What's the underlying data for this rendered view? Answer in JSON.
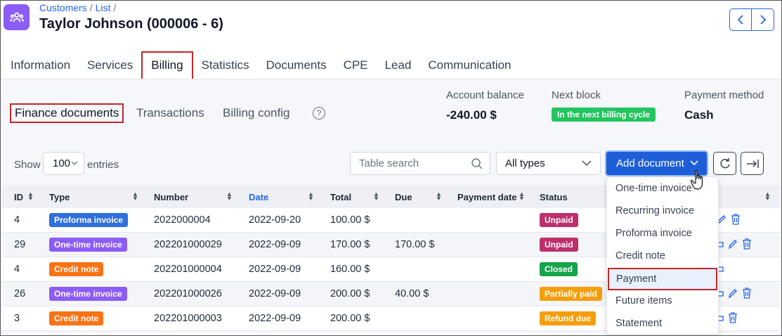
{
  "breadcrumb": {
    "customers": "Customers",
    "list": "List"
  },
  "page_title": "Taylor Johnson (000006 - 6)",
  "tabs": [
    {
      "label": "Information"
    },
    {
      "label": "Services"
    },
    {
      "label": "Billing"
    },
    {
      "label": "Statistics"
    },
    {
      "label": "Documents"
    },
    {
      "label": "CPE"
    },
    {
      "label": "Lead"
    },
    {
      "label": "Communication"
    }
  ],
  "active_tab": "Billing",
  "subtabs": [
    {
      "label": "Finance documents"
    },
    {
      "label": "Transactions"
    },
    {
      "label": "Billing config"
    }
  ],
  "help_glyph": "?",
  "stats": {
    "account_balance_label": "Account balance",
    "account_balance_value": "-240.00 $",
    "next_block_label": "Next block",
    "next_block_value": "In the next billing cycle",
    "payment_method_label": "Payment method",
    "payment_method_value": "Cash"
  },
  "controls": {
    "show_label": "Show",
    "entries_value": "100",
    "entries_label": "entries",
    "search_placeholder": "Table search",
    "type_filter": "All types",
    "add_document": "Add document"
  },
  "table": {
    "headers": [
      "ID",
      "Type",
      "Number",
      "Date",
      "Total",
      "Due",
      "Payment date",
      "Status"
    ],
    "rows": [
      {
        "id": "4",
        "type": "Proforma invoice",
        "type_kind": "proforma",
        "number": "2022000004",
        "date": "2022-09-20",
        "total": "100.00 $",
        "due": "",
        "payment_date": "",
        "status": "Unpaid",
        "status_kind": "unpaid"
      },
      {
        "id": "29",
        "type": "One-time invoice",
        "type_kind": "onetime",
        "number": "202201000029",
        "date": "2022-09-09",
        "total": "170.00 $",
        "due": "170.00 $",
        "payment_date": "",
        "status": "Unpaid",
        "status_kind": "unpaid"
      },
      {
        "id": "4",
        "type": "Credit note",
        "type_kind": "credit",
        "number": "202201000004",
        "date": "2022-09-09",
        "total": "160.00 $",
        "due": "",
        "payment_date": "",
        "status": "Closed",
        "status_kind": "closed"
      },
      {
        "id": "26",
        "type": "One-time invoice",
        "type_kind": "onetime",
        "number": "202201000026",
        "date": "2022-09-09",
        "total": "200.00 $",
        "due": "40.00 $",
        "payment_date": "",
        "status": "Partially paid",
        "status_kind": "partial"
      },
      {
        "id": "3",
        "type": "Credit note",
        "type_kind": "credit",
        "number": "202201000003",
        "date": "2022-09-09",
        "total": "200.00 $",
        "due": "",
        "payment_date": "",
        "status": "Refund due",
        "status_kind": "refund"
      }
    ]
  },
  "dropdown_items": [
    {
      "label": "One-time invoice"
    },
    {
      "label": "Recurring invoice"
    },
    {
      "label": "Proforma invoice"
    },
    {
      "label": "Credit note"
    },
    {
      "label": "Payment"
    },
    {
      "label": "Future items"
    },
    {
      "label": "Statement"
    }
  ],
  "dropdown_selected": "Payment",
  "colors": {
    "accent": "#1e5fd9",
    "app_icon": "#8b5cf6",
    "highlight_border": "#c0262d",
    "proforma": "#2f6fdf",
    "onetime": "#8b5cf6",
    "credit": "#f97316",
    "unpaid": "#be2f6c",
    "closed": "#16a34a",
    "partial": "#f59e0b",
    "next_block": "#22c55e"
  }
}
